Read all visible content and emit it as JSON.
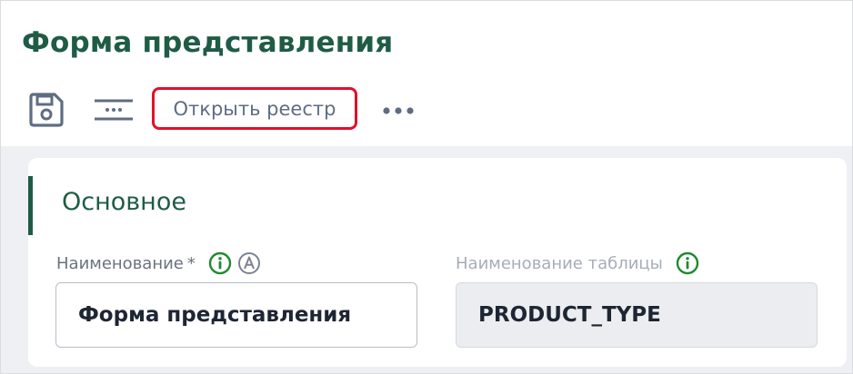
{
  "page": {
    "title": "Форма представления"
  },
  "toolbar": {
    "save_icon": "save-icon",
    "list_icon": "list-settings-icon",
    "open_registry_label": "Открыть реестр",
    "more_icon": "more-dots-icon",
    "highlight_color": "#e0112b"
  },
  "section": {
    "title": "Основное",
    "accent_color": "#1f5c45"
  },
  "fields": {
    "name": {
      "label": "Наименование",
      "required_mark": "*",
      "value": "Форма представления",
      "info_icon": "info-icon",
      "auto_icon": "auto-letter-a-icon"
    },
    "table_name": {
      "label": "Наименование таблицы",
      "value": "PRODUCT_TYPE",
      "info_icon": "info-icon",
      "disabled": true
    }
  }
}
